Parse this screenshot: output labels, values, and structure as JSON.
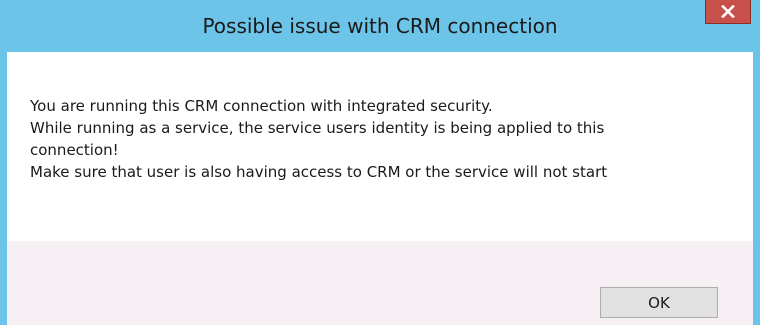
{
  "dialog": {
    "title": "Possible issue with CRM connection",
    "close_icon": "close-icon",
    "message_lines": [
      "You are running this CRM connection with integrated security.",
      "While running as a service, the service users identity is being applied to this",
      "connection!",
      "Make sure that user is also having access to CRM or the service will not start"
    ],
    "ok_label": "OK"
  },
  "colors": {
    "titlebar": "#6cc4e8",
    "close_button": "#c7504b",
    "button_area": "#f6f0f4",
    "ok_button": "#e1e1e1"
  }
}
